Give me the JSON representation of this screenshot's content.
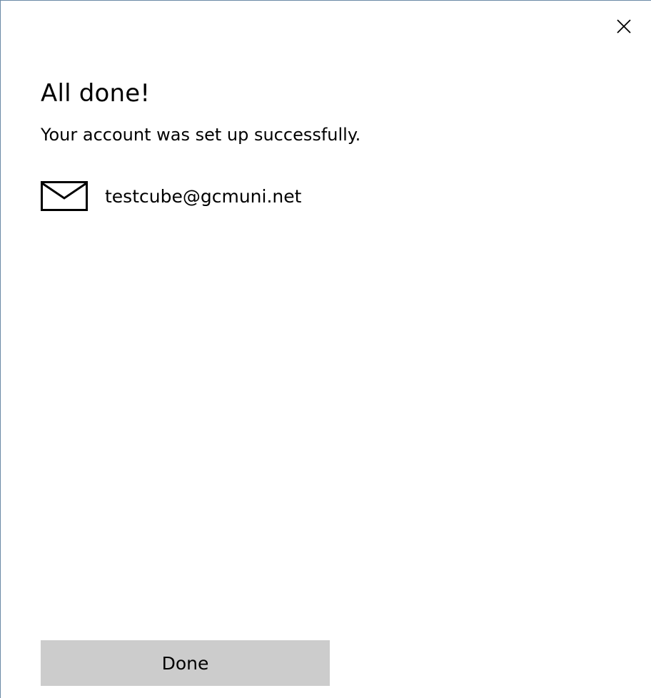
{
  "dialog": {
    "title": "All done!",
    "subtitle": "Your account was set up successfully.",
    "close_icon": "close-icon"
  },
  "account": {
    "icon": "mail-icon",
    "email": "testcube@gcmuni.net"
  },
  "actions": {
    "done_label": "Done"
  },
  "colors": {
    "background": "#ffffff",
    "button_background": "#cccccc",
    "text": "#000000",
    "border": "#6b8aa6"
  }
}
